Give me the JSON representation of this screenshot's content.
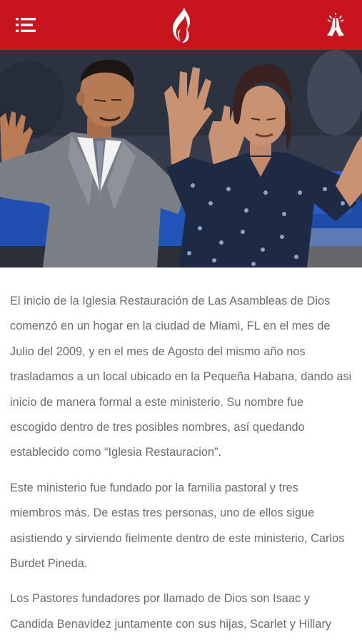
{
  "header": {
    "menu_icon": "hamburger-menu-icon",
    "logo_icon": "flame-logo-icon",
    "action_icon": "praying-hands-icon",
    "background_color": "#c8141c"
  },
  "hero": {
    "image": "worship-photo"
  },
  "article": {
    "paragraphs": [
      "El inicio de la Iglesia Restauración de Las Asambleas de Dios comenzó en un hogar en la ciudad de Miami, FL en el mes de Julio del 2009, y en el mes de Agosto del mismo año nos trasladamos a un local ubicado en la Pequeña Habana, dando asi inicio de manera formal a este ministerio. Su nombre fue escogido dentro de tres posibles nombres, así quedando establecido como “Iglesia Restauracion”.",
      "Este ministerio fue fundado por la familia pastoral y tres miembros más. De estas tres personas, uno de ellos sigue asistiendo y sirviendo fielmente dentro de este ministerio, Carlos Burdet Pineda.",
      "Los Pastores fundadores por llamado de Dios son Isaac y Candida Benavidez juntamente con sus hijas, Scarlet y Hillary"
    ]
  }
}
